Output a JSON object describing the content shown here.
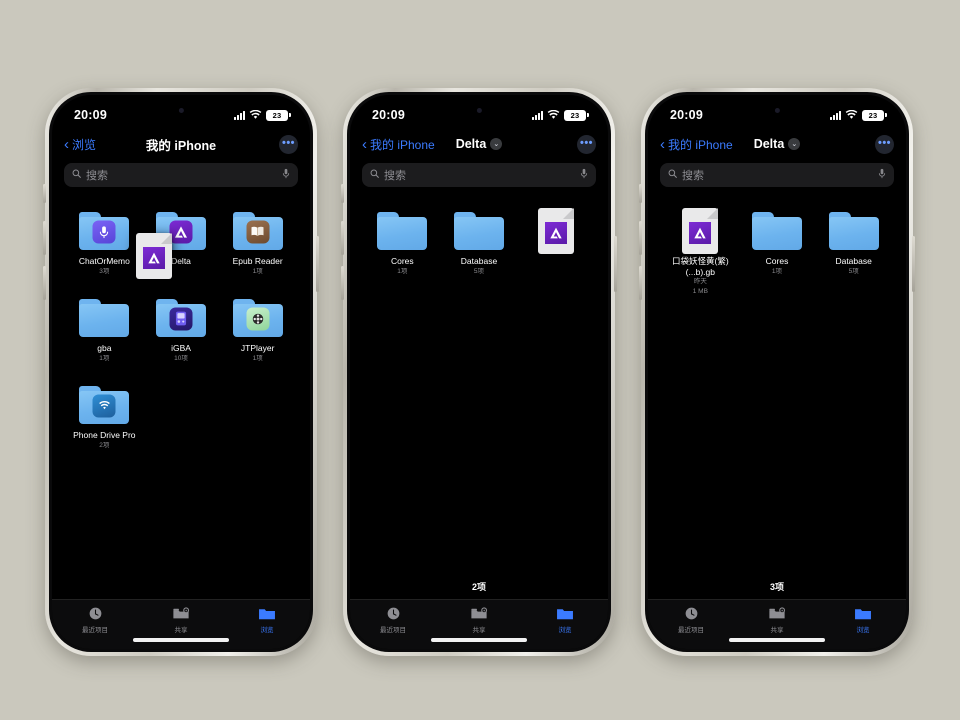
{
  "canvas": {
    "background": "#cac8bd"
  },
  "accent": {
    "blue": "#3b7bff",
    "folder": "#6cb3ee",
    "delta_purple": "#6f24c4"
  },
  "status_bar": {
    "time": "20:09",
    "battery_level": "23",
    "cell_icon": "cellular-signal-icon",
    "wifi_icon": "wifi-icon",
    "battery_icon": "battery-icon"
  },
  "shared": {
    "search_placeholder": "搜索",
    "search_icon": "search-icon",
    "mic_icon": "microphone-icon",
    "more_label": "•••",
    "back_chevron": "‹",
    "dropdown_chevron": "⌄",
    "tabs": [
      {
        "label": "最近项目",
        "icon": "clock-icon",
        "active": false
      },
      {
        "label": "共享",
        "icon": "shared-folder-lock-icon",
        "active": false
      },
      {
        "label": "浏览",
        "icon": "folder-icon",
        "active": true
      }
    ]
  },
  "phones": [
    {
      "id": "phone-1",
      "nav": {
        "back": "浏览",
        "title": "我的 iPhone",
        "has_dropdown": false
      },
      "files": [
        {
          "name": "ChatOrMemo",
          "sub": "3项",
          "type": "folder",
          "app": "chat",
          "glyph": "microphone-note-icon"
        },
        {
          "name": "Delta",
          "sub": "",
          "type": "folder",
          "app": "delta",
          "glyph": "delta-triangle-icon",
          "obscured": true
        },
        {
          "name": "Epub Reader",
          "sub": "1项",
          "type": "folder",
          "app": "epub",
          "glyph": "open-book-icon"
        },
        {
          "name": "gba",
          "sub": "1项",
          "type": "folder",
          "app": "",
          "glyph": ""
        },
        {
          "name": "iGBA",
          "sub": "10项",
          "type": "folder",
          "app": "igba",
          "glyph": "handheld-console-icon"
        },
        {
          "name": "JTPlayer",
          "sub": "1项",
          "type": "folder",
          "app": "jt",
          "glyph": "film-reel-icon"
        },
        {
          "name": "Phone Drive Pro",
          "sub": "2项",
          "type": "folder",
          "app": "pdp",
          "glyph": "wifi-drive-icon"
        }
      ],
      "drag_ghost": {
        "label": "",
        "type": "document",
        "glyph": "delta-triangle-icon"
      },
      "item_count": ""
    },
    {
      "id": "phone-2",
      "nav": {
        "back": "我的 iPhone",
        "title": "Delta",
        "has_dropdown": true
      },
      "files": [
        {
          "name": "Cores",
          "sub": "1项",
          "type": "folder",
          "app": "",
          "glyph": ""
        },
        {
          "name": "Database",
          "sub": "5项",
          "type": "folder",
          "app": "",
          "glyph": ""
        },
        {
          "name": "",
          "sub": "",
          "type": "document",
          "app": "delta",
          "glyph": "delta-triangle-icon",
          "dragging": true
        }
      ],
      "item_count": "2项"
    },
    {
      "id": "phone-3",
      "nav": {
        "back": "我的 iPhone",
        "title": "Delta",
        "has_dropdown": true
      },
      "files": [
        {
          "name": "口袋妖怪黄(繁) (...b).gb",
          "sub": "昨天",
          "sub2": "1 MB",
          "type": "document",
          "app": "delta",
          "glyph": "delta-triangle-icon"
        },
        {
          "name": "Cores",
          "sub": "1项",
          "type": "folder",
          "app": "",
          "glyph": ""
        },
        {
          "name": "Database",
          "sub": "5项",
          "type": "folder",
          "app": "",
          "glyph": ""
        }
      ],
      "item_count": "3项"
    }
  ]
}
